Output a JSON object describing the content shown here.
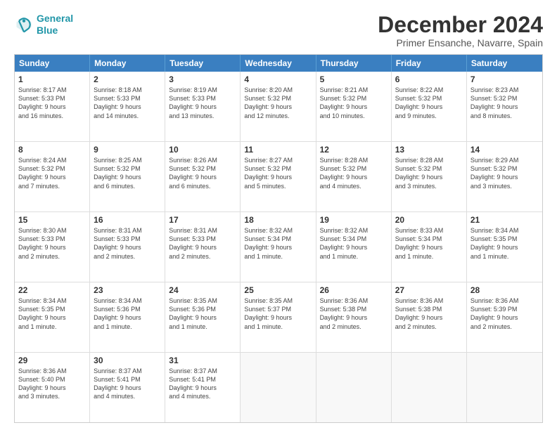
{
  "logo": {
    "line1": "General",
    "line2": "Blue"
  },
  "title": "December 2024",
  "location": "Primer Ensanche, Navarre, Spain",
  "header_days": [
    "Sunday",
    "Monday",
    "Tuesday",
    "Wednesday",
    "Thursday",
    "Friday",
    "Saturday"
  ],
  "weeks": [
    [
      {
        "day": "1",
        "lines": [
          "Sunrise: 8:17 AM",
          "Sunset: 5:33 PM",
          "Daylight: 9 hours",
          "and 16 minutes."
        ]
      },
      {
        "day": "2",
        "lines": [
          "Sunrise: 8:18 AM",
          "Sunset: 5:33 PM",
          "Daylight: 9 hours",
          "and 14 minutes."
        ]
      },
      {
        "day": "3",
        "lines": [
          "Sunrise: 8:19 AM",
          "Sunset: 5:33 PM",
          "Daylight: 9 hours",
          "and 13 minutes."
        ]
      },
      {
        "day": "4",
        "lines": [
          "Sunrise: 8:20 AM",
          "Sunset: 5:32 PM",
          "Daylight: 9 hours",
          "and 12 minutes."
        ]
      },
      {
        "day": "5",
        "lines": [
          "Sunrise: 8:21 AM",
          "Sunset: 5:32 PM",
          "Daylight: 9 hours",
          "and 10 minutes."
        ]
      },
      {
        "day": "6",
        "lines": [
          "Sunrise: 8:22 AM",
          "Sunset: 5:32 PM",
          "Daylight: 9 hours",
          "and 9 minutes."
        ]
      },
      {
        "day": "7",
        "lines": [
          "Sunrise: 8:23 AM",
          "Sunset: 5:32 PM",
          "Daylight: 9 hours",
          "and 8 minutes."
        ]
      }
    ],
    [
      {
        "day": "8",
        "lines": [
          "Sunrise: 8:24 AM",
          "Sunset: 5:32 PM",
          "Daylight: 9 hours",
          "and 7 minutes."
        ]
      },
      {
        "day": "9",
        "lines": [
          "Sunrise: 8:25 AM",
          "Sunset: 5:32 PM",
          "Daylight: 9 hours",
          "and 6 minutes."
        ]
      },
      {
        "day": "10",
        "lines": [
          "Sunrise: 8:26 AM",
          "Sunset: 5:32 PM",
          "Daylight: 9 hours",
          "and 6 minutes."
        ]
      },
      {
        "day": "11",
        "lines": [
          "Sunrise: 8:27 AM",
          "Sunset: 5:32 PM",
          "Daylight: 9 hours",
          "and 5 minutes."
        ]
      },
      {
        "day": "12",
        "lines": [
          "Sunrise: 8:28 AM",
          "Sunset: 5:32 PM",
          "Daylight: 9 hours",
          "and 4 minutes."
        ]
      },
      {
        "day": "13",
        "lines": [
          "Sunrise: 8:28 AM",
          "Sunset: 5:32 PM",
          "Daylight: 9 hours",
          "and 3 minutes."
        ]
      },
      {
        "day": "14",
        "lines": [
          "Sunrise: 8:29 AM",
          "Sunset: 5:32 PM",
          "Daylight: 9 hours",
          "and 3 minutes."
        ]
      }
    ],
    [
      {
        "day": "15",
        "lines": [
          "Sunrise: 8:30 AM",
          "Sunset: 5:33 PM",
          "Daylight: 9 hours",
          "and 2 minutes."
        ]
      },
      {
        "day": "16",
        "lines": [
          "Sunrise: 8:31 AM",
          "Sunset: 5:33 PM",
          "Daylight: 9 hours",
          "and 2 minutes."
        ]
      },
      {
        "day": "17",
        "lines": [
          "Sunrise: 8:31 AM",
          "Sunset: 5:33 PM",
          "Daylight: 9 hours",
          "and 2 minutes."
        ]
      },
      {
        "day": "18",
        "lines": [
          "Sunrise: 8:32 AM",
          "Sunset: 5:34 PM",
          "Daylight: 9 hours",
          "and 1 minute."
        ]
      },
      {
        "day": "19",
        "lines": [
          "Sunrise: 8:32 AM",
          "Sunset: 5:34 PM",
          "Daylight: 9 hours",
          "and 1 minute."
        ]
      },
      {
        "day": "20",
        "lines": [
          "Sunrise: 8:33 AM",
          "Sunset: 5:34 PM",
          "Daylight: 9 hours",
          "and 1 minute."
        ]
      },
      {
        "day": "21",
        "lines": [
          "Sunrise: 8:34 AM",
          "Sunset: 5:35 PM",
          "Daylight: 9 hours",
          "and 1 minute."
        ]
      }
    ],
    [
      {
        "day": "22",
        "lines": [
          "Sunrise: 8:34 AM",
          "Sunset: 5:35 PM",
          "Daylight: 9 hours",
          "and 1 minute."
        ]
      },
      {
        "day": "23",
        "lines": [
          "Sunrise: 8:34 AM",
          "Sunset: 5:36 PM",
          "Daylight: 9 hours",
          "and 1 minute."
        ]
      },
      {
        "day": "24",
        "lines": [
          "Sunrise: 8:35 AM",
          "Sunset: 5:36 PM",
          "Daylight: 9 hours",
          "and 1 minute."
        ]
      },
      {
        "day": "25",
        "lines": [
          "Sunrise: 8:35 AM",
          "Sunset: 5:37 PM",
          "Daylight: 9 hours",
          "and 1 minute."
        ]
      },
      {
        "day": "26",
        "lines": [
          "Sunrise: 8:36 AM",
          "Sunset: 5:38 PM",
          "Daylight: 9 hours",
          "and 2 minutes."
        ]
      },
      {
        "day": "27",
        "lines": [
          "Sunrise: 8:36 AM",
          "Sunset: 5:38 PM",
          "Daylight: 9 hours",
          "and 2 minutes."
        ]
      },
      {
        "day": "28",
        "lines": [
          "Sunrise: 8:36 AM",
          "Sunset: 5:39 PM",
          "Daylight: 9 hours",
          "and 2 minutes."
        ]
      }
    ],
    [
      {
        "day": "29",
        "lines": [
          "Sunrise: 8:36 AM",
          "Sunset: 5:40 PM",
          "Daylight: 9 hours",
          "and 3 minutes."
        ]
      },
      {
        "day": "30",
        "lines": [
          "Sunrise: 8:37 AM",
          "Sunset: 5:41 PM",
          "Daylight: 9 hours",
          "and 4 minutes."
        ]
      },
      {
        "day": "31",
        "lines": [
          "Sunrise: 8:37 AM",
          "Sunset: 5:41 PM",
          "Daylight: 9 hours",
          "and 4 minutes."
        ]
      },
      {
        "day": "",
        "lines": []
      },
      {
        "day": "",
        "lines": []
      },
      {
        "day": "",
        "lines": []
      },
      {
        "day": "",
        "lines": []
      }
    ]
  ]
}
